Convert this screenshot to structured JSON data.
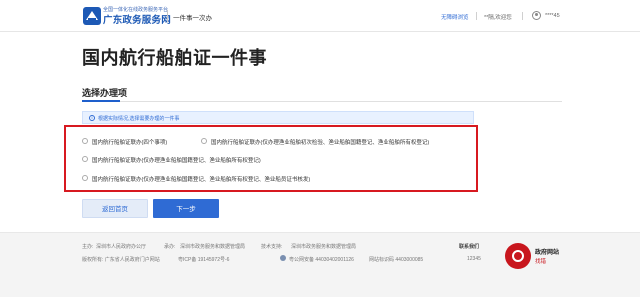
{
  "header": {
    "site_subtitle": "全国一体化在线政务服务平台",
    "site_name": "广东政务服务网",
    "slogan": "一件事一次办",
    "accessibility_link": "无障碍浏览",
    "location_text": "**隔,欢迎您",
    "user_text": "****45"
  },
  "main": {
    "page_title": "国内航行船舶证一件事",
    "section_title": "选择办理项",
    "tip": "根据实际情况,选择需要办理的一件事",
    "options": [
      {
        "label": "国内航行船舶证联办(四个事项)"
      },
      {
        "label": "国内航行船舶证联办(仅办理渔业船舶初次检验、渔业船舶国籍登记、渔业船舶所有权登记)"
      },
      {
        "label": "国内航行船舶证联办(仅办理渔业船舶国籍登记、渔业船舶所有权登记)"
      },
      {
        "label": "国内航行船舶证联办(仅办理渔业船舶国籍登记、渔业船舶所有权登记、渔业船员证书核发)"
      }
    ],
    "back_button": "返回首页",
    "next_button": "下一步"
  },
  "footer": {
    "host_label": "主办:",
    "host": "深圳市人民政府办公厅",
    "organizer_label": "承办:",
    "organizer": "深圳市政务服务和数据管理局",
    "tech_label": "技术支持:",
    "tech": "深圳市政务服务和数据管理局",
    "contact_label": "联系我们",
    "contact_number": "12345",
    "copyright": "版权所有: 广东省人民政府门户网站",
    "icp": "粤ICP备 19145972号-6",
    "police_record": "粤公网安备 44030402001126",
    "site_code": "网站标识码 4403000085",
    "gov_badge_title": "政府网站",
    "gov_badge_sub": "找错"
  },
  "colors": {
    "brand_blue": "#1d59b5",
    "primary_button": "#2f6bd4",
    "highlight_box": "#d71920",
    "tip_background": "#e8f1ff"
  }
}
